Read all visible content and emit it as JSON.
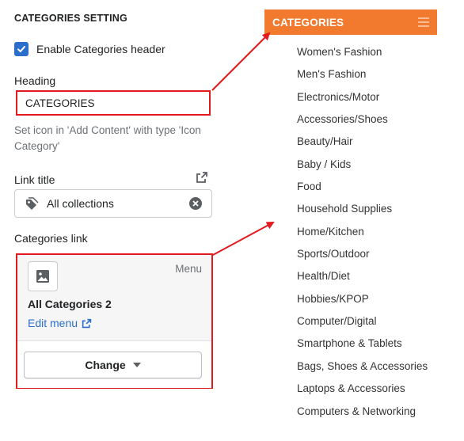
{
  "settings": {
    "section_title": "CATEGORIES SETTING",
    "enable_header_label": "Enable Categories header",
    "enable_header_checked": true,
    "heading_label": "Heading",
    "heading_value": "CATEGORIES",
    "help_text": "Set icon in 'Add Content' with type 'Icon Category'",
    "link_title_label": "Link title",
    "link_title_value": "All collections",
    "categories_link_label": "Categories link",
    "menu": {
      "tag": "Menu",
      "name": "All Categories 2",
      "edit_label": "Edit menu",
      "change_label": "Change"
    }
  },
  "preview": {
    "header_title": "CATEGORIES",
    "items": [
      "Women's Fashion",
      "Men's Fashion",
      "Electronics/Motor",
      "Accessories/Shoes",
      "Beauty/Hair",
      "Baby / Kids",
      "Food",
      "Household Supplies",
      "Home/Kitchen",
      "Sports/Outdoor",
      "Health/Diet",
      "Hobbies/KPOP",
      "Computer/Digital",
      "Smartphone & Tablets",
      "Bags, Shoes & Accessories",
      "Laptops & Accessories",
      "Computers & Networking"
    ]
  },
  "colors": {
    "accent_blue": "#2c6ecb",
    "highlight_red": "#e4191e",
    "header_orange": "#f27a2e"
  }
}
